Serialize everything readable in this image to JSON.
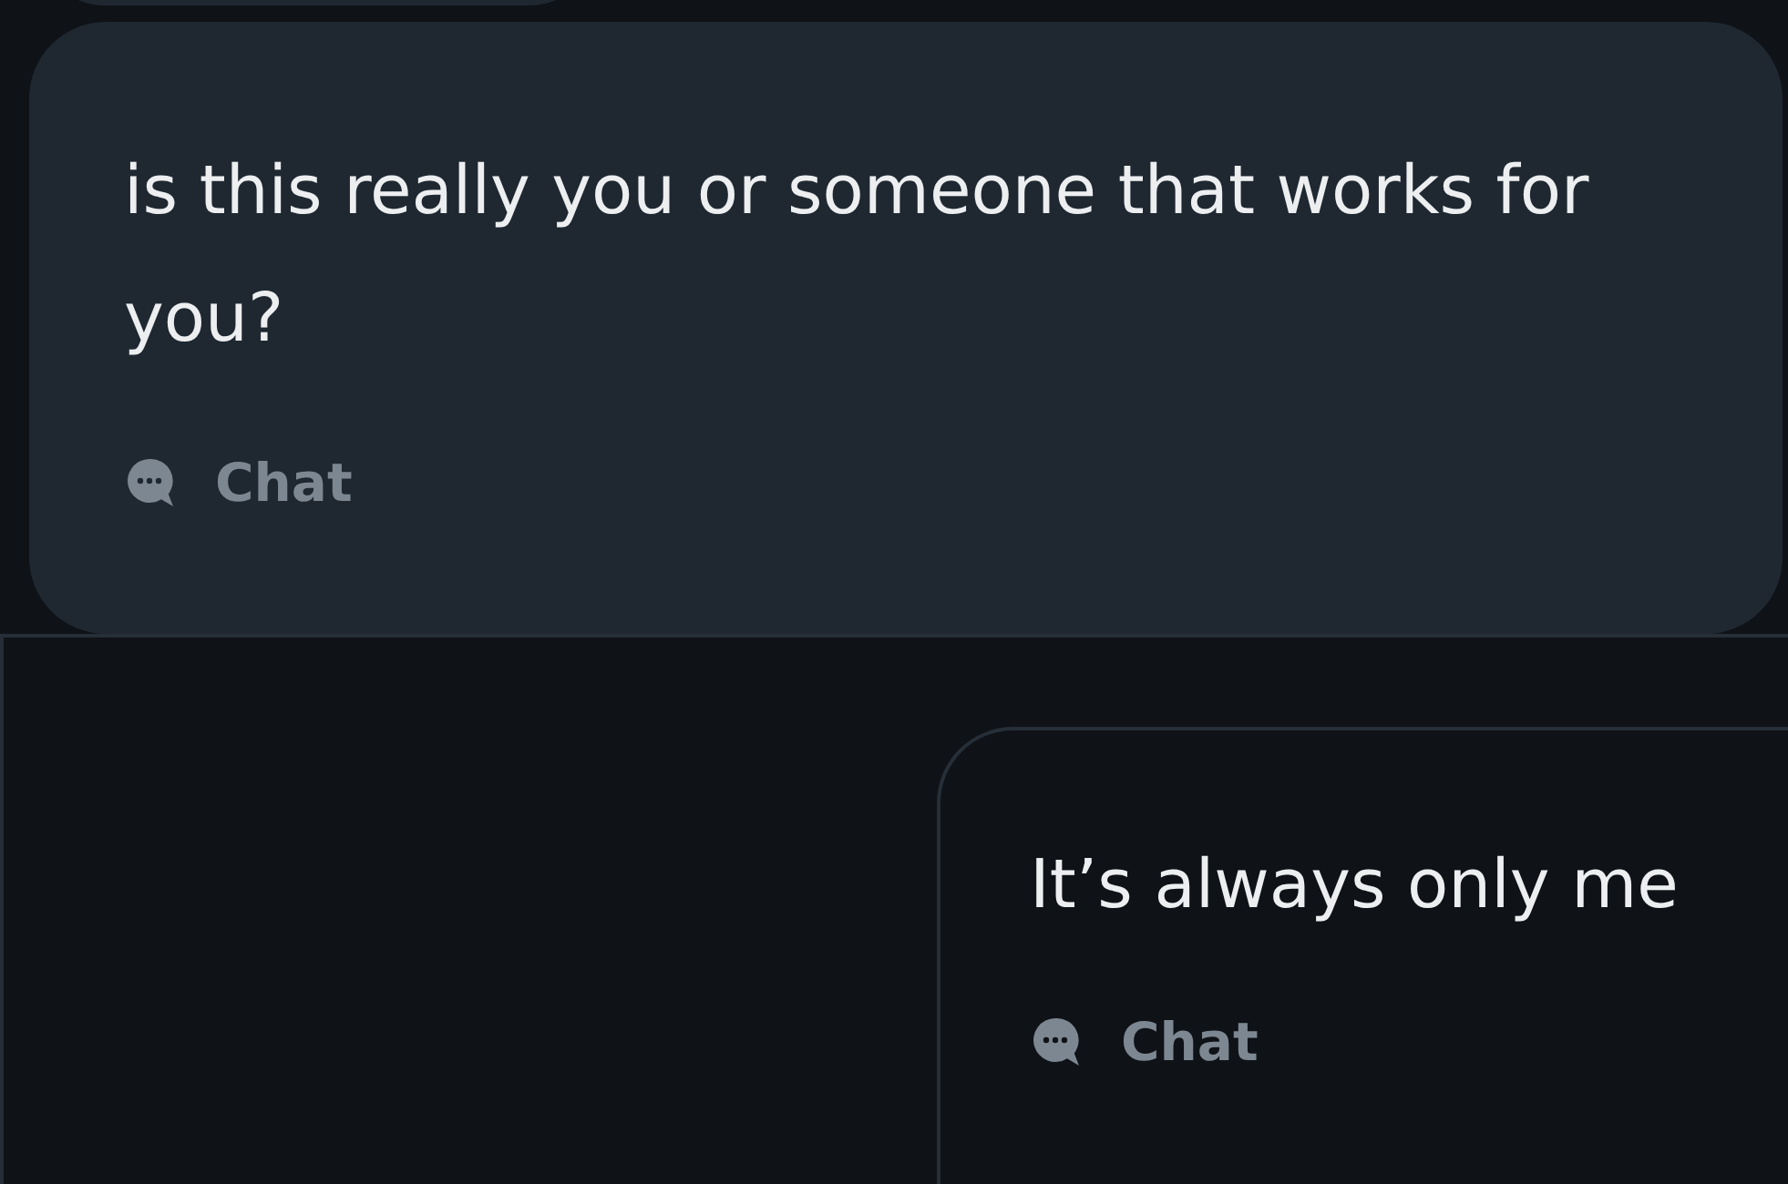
{
  "messages": [
    {
      "kind": "received",
      "text": "is this really you or someone that works for you?",
      "action": "Chat"
    },
    {
      "kind": "sent",
      "text": "It’s always only me",
      "action": "Chat"
    }
  ]
}
